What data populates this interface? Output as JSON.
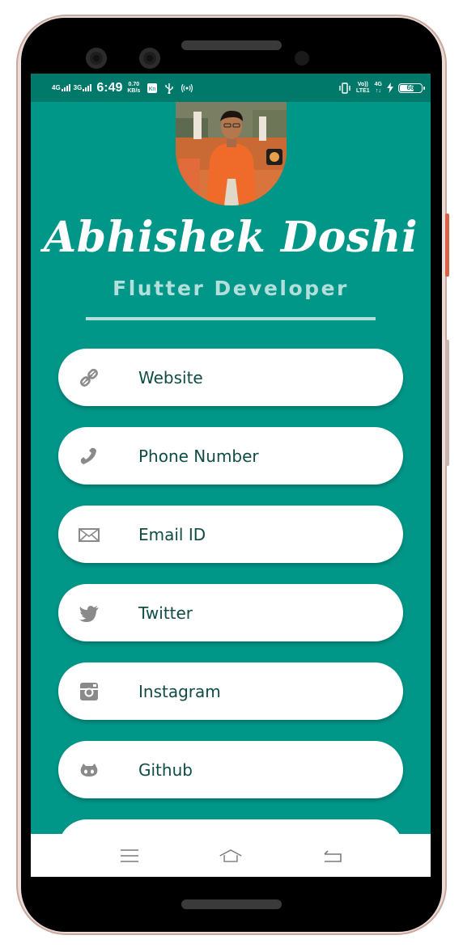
{
  "status_bar": {
    "network_1": "4G",
    "network_2": "3G",
    "time": "6:49",
    "speed_value": "0.70",
    "speed_unit": "KB/s",
    "lte_top": "Vo))",
    "lte_bottom": "LTE1",
    "network_right": "4G",
    "battery": "66"
  },
  "profile": {
    "name": "Abhishek Doshi",
    "title": "Flutter Developer"
  },
  "links": [
    {
      "label": "Website",
      "icon": "link-icon"
    },
    {
      "label": "Phone Number",
      "icon": "phone-icon"
    },
    {
      "label": "Email ID",
      "icon": "email-icon"
    },
    {
      "label": "Twitter",
      "icon": "twitter-icon"
    },
    {
      "label": "Instagram",
      "icon": "instagram-icon"
    },
    {
      "label": "Github",
      "icon": "github-icon"
    }
  ],
  "colors": {
    "background": "#009688",
    "status_bar": "#00796b",
    "card": "#ffffff",
    "card_text": "#0f4c44",
    "subtitle": "#b2dfdb",
    "icon": "#8a8a8a"
  },
  "nav_bar": {
    "icons": [
      "menu-icon",
      "home-icon",
      "back-icon"
    ]
  }
}
